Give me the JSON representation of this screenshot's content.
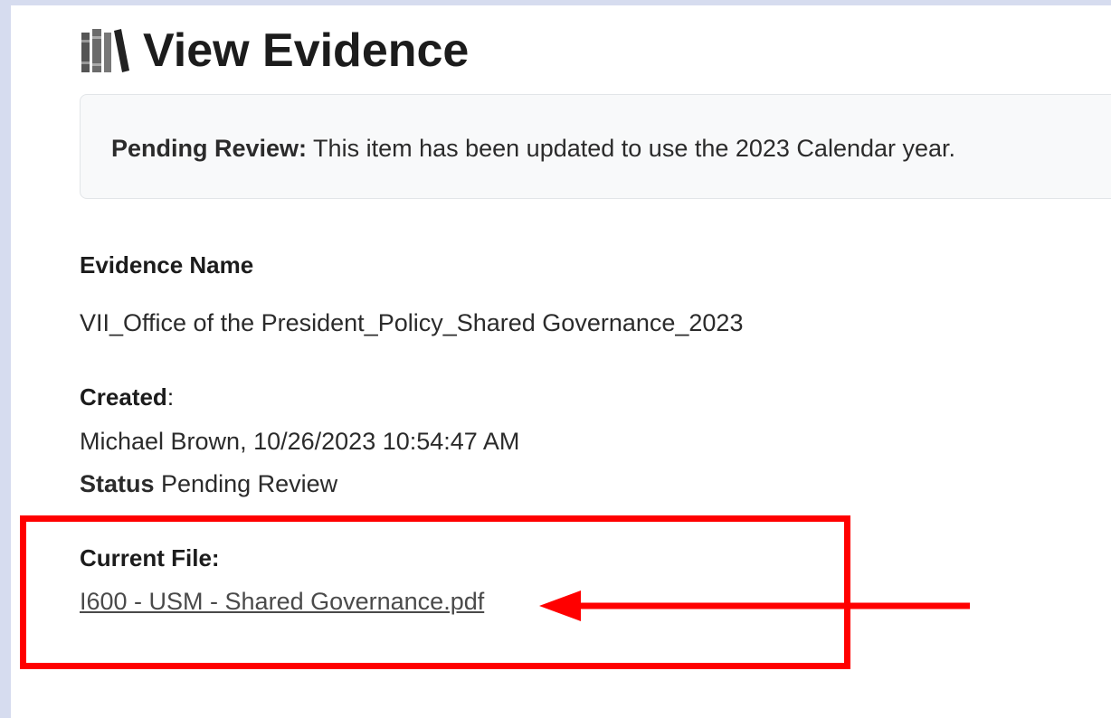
{
  "page": {
    "title": "View Evidence",
    "title_icon": "books-icon"
  },
  "alert": {
    "label": "Pending Review:",
    "message": " This item has been updated to use the 2023 Calendar year."
  },
  "evidence_name": {
    "label": "Evidence Name",
    "value": "VII_Office of the President_Policy_Shared Governance_2023"
  },
  "created": {
    "label": "Created",
    "colon": ":",
    "value": "Michael Brown, 10/26/2023 10:54:47 AM"
  },
  "status": {
    "label": "Status",
    "value": " Pending Review"
  },
  "current_file": {
    "label": "Current File:",
    "link": "I600 - USM - Shared Governance.pdf"
  },
  "colors": {
    "annotation": "#ff0000",
    "background": "#d6dcef"
  }
}
